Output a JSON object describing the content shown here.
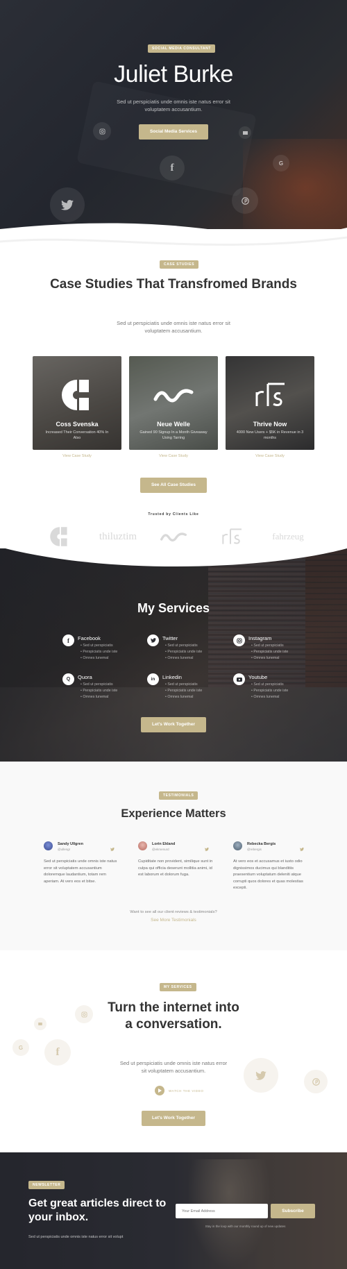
{
  "hero": {
    "badge": "Social Media Consultant",
    "title": "Juliet Burke",
    "subtitle": "Sed ut perspiciatis unde omnis iste natus error sit voluptatem accusantium.",
    "button": "Social Media Services",
    "icons": [
      "instagram-icon",
      "email-icon",
      "facebook-icon",
      "google-icon",
      "twitter-icon",
      "pinterest-icon"
    ]
  },
  "case_studies": {
    "badge": "Case Studies",
    "title": "Case Studies That Transfromed Brands",
    "subtitle": "Sed ut perspiciatis unde omnis iste natus error sit voluptatem accusantium.",
    "cards": [
      {
        "title": "Coss Svenska",
        "desc": "Increased Their Conversation 40% In Also",
        "link": "View Case Study"
      },
      {
        "title": "Neue Welle",
        "desc": "Gained 90 Signup In a Month Giveaway Using Tarring",
        "link": "View Case Study"
      },
      {
        "title": "Thrive Now",
        "desc": "4000 New Users + $5K in Revenue in 3 months",
        "link": "View Case Study"
      }
    ],
    "button": "See All Case Studies",
    "trusted": "Trusted by Clients Like",
    "client_logos": [
      "thiluztim",
      "fahrzeug"
    ]
  },
  "services": {
    "title": "My Services",
    "items": [
      {
        "name": "Facebook",
        "icon": "facebook-icon",
        "bullets": [
          "Sed ut perspiciatis",
          "Perspiciatis unde iste",
          "Omnes lunemal"
        ]
      },
      {
        "name": "Twitter",
        "icon": "twitter-icon",
        "bullets": [
          "Sed ut perspiciatis",
          "Perspiciatis unde iste",
          "Omnes lunemal"
        ]
      },
      {
        "name": "Instagram",
        "icon": "instagram-icon",
        "bullets": [
          "Sed ut perspiciatis",
          "Perspiciatis unde iste",
          "Omnes lunemal"
        ]
      },
      {
        "name": "Quora",
        "icon": "quora-icon",
        "bullets": [
          "Sed ut perspiciatis",
          "Perspiciatis unde iste",
          "Omnes lunemal"
        ]
      },
      {
        "name": "Linkedin",
        "icon": "linkedin-icon",
        "bullets": [
          "Sed ut perspiciatis",
          "Perspiciatis unde iste",
          "Omnes lunemal"
        ]
      },
      {
        "name": "Youtube",
        "icon": "youtube-icon",
        "bullets": [
          "Sed ut perspiciatis",
          "Perspiciatis unde iste",
          "Omnes lunemal"
        ]
      }
    ],
    "button": "Let's Work Together"
  },
  "testimonials": {
    "badge": "Testimonials",
    "title": "Experience Matters",
    "items": [
      {
        "name": "Sandy Ullgren",
        "handle": "@ullengr",
        "text": "Sed ut perspiciatis unde omnis iste natus error sit voluptatem accusantium doloremque laudantium, totam rem aperiam. At vero eos et bitse."
      },
      {
        "name": "Lorin Ekland",
        "handle": "@ekmenurd",
        "text": "Cupiditate non provident, similique sunt in culpa qui officia deserunt mollitia animi, id est laborum et dolorum fuga."
      },
      {
        "name": "Rebecka Bergis",
        "handle": "@rebergis",
        "text": "At vero eos et accusamus et iusto odio dignissimos ducimus qui blanditiis praesentium voluptatum deleniti atque corrupti quos dolores et quas molestias excepti."
      }
    ],
    "prompt": "Want to see all our client reviews & testimonials?",
    "link": "See More Testimonials"
  },
  "conversation": {
    "badge": "My Services",
    "title": "Turn the internet into a conversation.",
    "subtitle": "Sed ut perspiciatis unde omnis iste natus error sit voluptatem accusantium.",
    "watch": "Watch the video",
    "button": "Let's Work Together"
  },
  "newsletter": {
    "badge": "Newsletter",
    "title": "Get great articles direct to your inbox.",
    "subtitle": "Sed ut perspiciatis unde omnis iste natus error sit volupt",
    "input_placeholder": "Your Email Address",
    "button": "Subscribe",
    "note": "Stay in the loop with our monthly round up of new updates"
  },
  "colors": {
    "accent": "#c5b78c",
    "dark": "#2b2e36"
  }
}
